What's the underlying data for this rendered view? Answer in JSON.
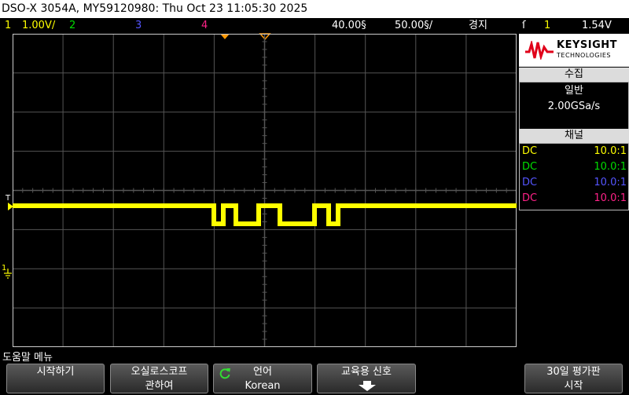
{
  "title_bar": "DSO-X 3054A, MY59120980: Thu Oct 23 11:05:30 2025",
  "status": {
    "ch1_num": "1",
    "ch1_scale": "1.00V/",
    "ch2_num": "2",
    "ch3_num": "3",
    "ch4_num": "4",
    "delay": "40.00§",
    "timebase": "50.00§/",
    "run_state": "경지",
    "trigger_icon": "ſ",
    "trigger_source": "1",
    "trigger_level": "1.54V"
  },
  "colors": {
    "ch1": "#ffff00",
    "ch2": "#00dd00",
    "ch3": "#5555ff",
    "ch4": "#ff2288",
    "grid": "#555555",
    "trigger_marker": "#ff9900"
  },
  "panel": {
    "brand": "KEYSIGHT",
    "brand_sub": "TECHNOLOGIES",
    "acq_title": "수집",
    "acq_mode": "일반",
    "sample_rate": "2.00GSa/s",
    "channels_title": "채널",
    "channels": [
      {
        "coupling": "DC",
        "probe": "10.0:1",
        "color": "#ffff00"
      },
      {
        "coupling": "DC",
        "probe": "10.0:1",
        "color": "#00dd00"
      },
      {
        "coupling": "DC",
        "probe": "10.0:1",
        "color": "#5555ff"
      },
      {
        "coupling": "DC",
        "probe": "10.0:1",
        "color": "#ff2288"
      }
    ]
  },
  "markers": {
    "trigger_level_label": "T",
    "ch1_ground_label": "1"
  },
  "menu": {
    "title": "도움말 메뉴",
    "softkeys": [
      {
        "line1": "시작하기",
        "line2": ""
      },
      {
        "line1": "오실로스코프",
        "line2": "관하여"
      },
      {
        "line1": "언어",
        "line2": "Korean",
        "icon": "rotate-icon"
      },
      {
        "line1": "교육용 신호",
        "line2": "",
        "icon": "down-arrow-icon"
      },
      {
        "line1": "30일 평가판",
        "line2": "시작"
      }
    ]
  }
}
